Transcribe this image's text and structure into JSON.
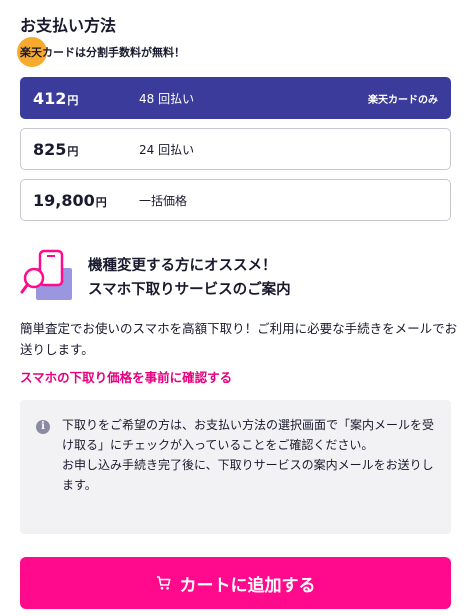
{
  "payment": {
    "title": "お支払い方法",
    "promo": "楽天カードは分割手数料が無料！",
    "plans": [
      {
        "price": "412",
        "unit": "円",
        "count": "48 回払い",
        "note": "楽天カードのみ",
        "selected": true
      },
      {
        "price": "825",
        "unit": "円",
        "count": "24 回払い"
      },
      {
        "price": "19,800",
        "unit": "円",
        "count": "一括価格"
      }
    ]
  },
  "trade_in": {
    "icon": "phone-search-icon",
    "heading_line1": "機種変更する方にオススメ！",
    "heading_line2": "スマホ下取りサービスのご案内",
    "description": "簡単査定でお使いのスマホを高額下取り！ご利用に必要な手続きをメールでお送りします。",
    "link": "スマホの下取り価格を事前に確認する"
  },
  "info": {
    "icon": "info-icon",
    "paragraph1": "下取りをご希望の方は、お支払い方法の選択画面で「案内メールを受け取る」にチェックが入っていることをご確認ください。",
    "paragraph2": "お申し込み手続き完了後に、下取りサービスの案内メールをお送りします。"
  },
  "cart": {
    "icon": "cart-icon",
    "label": "カートに追加する"
  },
  "colors": {
    "selected": "#3b3b9c",
    "accent": "#e6007e",
    "button": "#ff0a8c",
    "promo_dot": "#f5a623"
  }
}
